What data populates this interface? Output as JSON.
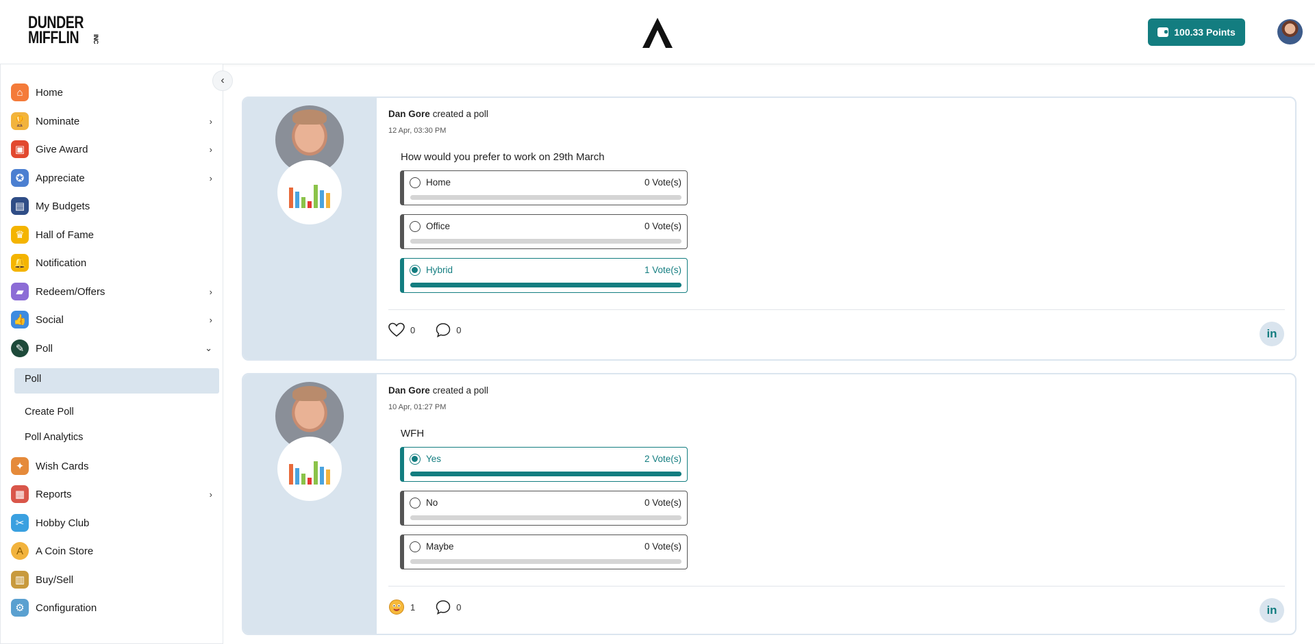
{
  "header": {
    "brand_line1": "DUNDER",
    "brand_line2": "MIFFLIN",
    "brand_suffix": "INC",
    "center_logo_letter": "A",
    "points_label": "100.33  Points",
    "accent_color": "#137d80"
  },
  "sidebar": {
    "collapse_icon": "chevron-left-icon",
    "items": [
      {
        "label": "Home",
        "icon": "home-icon",
        "chevron": ""
      },
      {
        "label": "Nominate",
        "icon": "trophy-icon",
        "chevron": "›"
      },
      {
        "label": "Give Award",
        "icon": "gift-icon",
        "chevron": "›"
      },
      {
        "label": "Appreciate",
        "icon": "ribbon-icon",
        "chevron": "›"
      },
      {
        "label": "My Budgets",
        "icon": "wallet-icon",
        "chevron": ""
      },
      {
        "label": "Hall of Fame",
        "icon": "crown-icon",
        "chevron": ""
      },
      {
        "label": "Notification",
        "icon": "bell-icon",
        "chevron": ""
      },
      {
        "label": "Redeem/Offers",
        "icon": "offers-icon",
        "chevron": "›"
      },
      {
        "label": "Social",
        "icon": "social-icon",
        "chevron": "›"
      },
      {
        "label": "Poll",
        "icon": "poll-icon",
        "chevron": "⌄"
      },
      {
        "label": "Wish Cards",
        "icon": "party-icon",
        "chevron": ""
      },
      {
        "label": "Reports",
        "icon": "clipboard-icon",
        "chevron": "›"
      },
      {
        "label": "Hobby Club",
        "icon": "hobby-icon",
        "chevron": ""
      },
      {
        "label": "A Coin Store",
        "icon": "coin-icon",
        "chevron": ""
      },
      {
        "label": "Buy/Sell",
        "icon": "bags-icon",
        "chevron": ""
      },
      {
        "label": "Configuration",
        "icon": "config-icon",
        "chevron": ""
      }
    ],
    "poll_submenu": [
      "Poll",
      "Create Poll",
      "Poll Analytics"
    ]
  },
  "posts": [
    {
      "author": "Dan Gore",
      "action": "created a poll",
      "date": "12 Apr, 03:30 PM",
      "question": "How would you prefer to work on 29th March",
      "options": [
        {
          "label": "Home",
          "votes": "0 Vote(s)",
          "selected": false,
          "fill": 0
        },
        {
          "label": "Office",
          "votes": "0 Vote(s)",
          "selected": false,
          "fill": 0
        },
        {
          "label": "Hybrid",
          "votes": "1 Vote(s)",
          "selected": true,
          "fill": 1.0
        }
      ],
      "reaction_icon": "heart-icon",
      "reactions": "0",
      "comments": "0",
      "share": "in"
    },
    {
      "author": "Dan Gore",
      "action": "created a poll",
      "date": "10 Apr, 01:27 PM",
      "question": "WFH",
      "options": [
        {
          "label": "Yes",
          "votes": "2 Vote(s)",
          "selected": true,
          "fill": 1.0
        },
        {
          "label": "No",
          "votes": "0 Vote(s)",
          "selected": false,
          "fill": 0
        },
        {
          "label": "Maybe",
          "votes": "0 Vote(s)",
          "selected": false,
          "fill": 0
        }
      ],
      "reaction_icon": "emoji-reaction-icon",
      "reactions": "1",
      "comments": "0",
      "share": "in"
    }
  ]
}
